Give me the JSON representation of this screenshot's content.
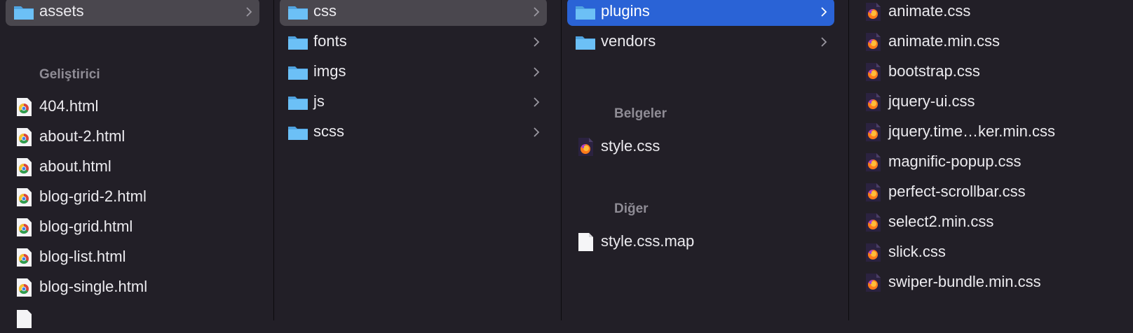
{
  "columns": [
    {
      "items": [
        {
          "label": "assets",
          "type": "folder",
          "selected": "gray",
          "chevron": true
        }
      ],
      "group": {
        "header": "Geliştirici",
        "items": [
          {
            "label": "404.html",
            "type": "chrome"
          },
          {
            "label": "about-2.html",
            "type": "chrome"
          },
          {
            "label": "about.html",
            "type": "chrome"
          },
          {
            "label": "blog-grid-2.html",
            "type": "chrome"
          },
          {
            "label": "blog-grid.html",
            "type": "chrome"
          },
          {
            "label": "blog-list.html",
            "type": "chrome"
          },
          {
            "label": "blog-single.html",
            "type": "chrome"
          }
        ]
      }
    },
    {
      "items": [
        {
          "label": "css",
          "type": "folder",
          "selected": "gray",
          "chevron": true
        },
        {
          "label": "fonts",
          "type": "folder",
          "chevron": true
        },
        {
          "label": "imgs",
          "type": "folder",
          "chevron": true
        },
        {
          "label": "js",
          "type": "folder",
          "chevron": true
        },
        {
          "label": "scss",
          "type": "folder",
          "chevron": true
        }
      ]
    },
    {
      "items": [
        {
          "label": "plugins",
          "type": "folder",
          "selected": "blue",
          "chevron": true
        },
        {
          "label": "vendors",
          "type": "folder",
          "chevron": true
        }
      ],
      "groups": [
        {
          "header": "Belgeler",
          "items": [
            {
              "label": "style.css",
              "type": "firefox"
            }
          ]
        },
        {
          "header": "Diğer",
          "items": [
            {
              "label": "style.css.map",
              "type": "doc"
            }
          ]
        }
      ]
    },
    {
      "items": [
        {
          "label": "animate.css",
          "type": "firefox"
        },
        {
          "label": "animate.min.css",
          "type": "firefox"
        },
        {
          "label": "bootstrap.css",
          "type": "firefox"
        },
        {
          "label": "jquery-ui.css",
          "type": "firefox"
        },
        {
          "label": "jquery.time…ker.min.css",
          "type": "firefox"
        },
        {
          "label": "magnific-popup.css",
          "type": "firefox"
        },
        {
          "label": "perfect-scrollbar.css",
          "type": "firefox"
        },
        {
          "label": "select2.min.css",
          "type": "firefox"
        },
        {
          "label": "slick.css",
          "type": "firefox"
        },
        {
          "label": "swiper-bundle.min.css",
          "type": "firefox"
        }
      ]
    }
  ],
  "colors": {
    "background": "#221f27",
    "selection_gray": "#4a474e",
    "selection_blue": "#2a63d6",
    "folder": "#5fb4f0",
    "group_header": "#8f8c95"
  }
}
